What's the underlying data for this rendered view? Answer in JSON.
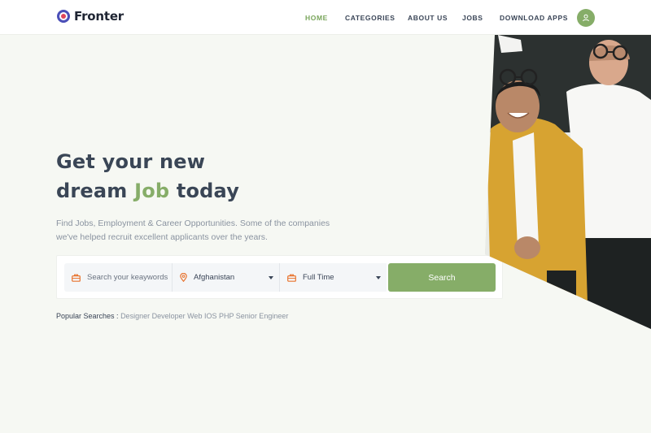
{
  "brand": {
    "name": "Fronter"
  },
  "nav": {
    "items": [
      {
        "label": "HOME",
        "active": true
      },
      {
        "label": "CATEGORIES",
        "active": false
      },
      {
        "label": "ABOUT US",
        "active": false
      },
      {
        "label": "JOBS",
        "active": false
      },
      {
        "label": "DOWNLOAD APPS",
        "active": false
      }
    ],
    "avatar_icon": "user-icon"
  },
  "hero": {
    "title_line1": "Get your new",
    "title_line2_before": "dream ",
    "title_line2_accent": "Job",
    "title_line2_after": " today",
    "description_line1": "Find Jobs, Employment & Career Opportunities. Some of the companies",
    "description_line2": "we've helped recruit excellent applicants over the years."
  },
  "search": {
    "keyword_placeholder": "Search your keaywords",
    "keyword_icon": "briefcase-icon",
    "location_value": "Afghanistan",
    "location_icon": "map-pin-icon",
    "job_type_value": "Full Time",
    "job_type_icon": "briefcase-icon",
    "button_label": "Search"
  },
  "popular": {
    "label": "Popular Searches :",
    "terms": "Designer Developer Web IOS PHP Senior Engineer"
  },
  "colors": {
    "accent": "#86ad68",
    "heading": "#3a4656",
    "icon_orange": "#e8742f",
    "background": "#f6f8f3"
  }
}
